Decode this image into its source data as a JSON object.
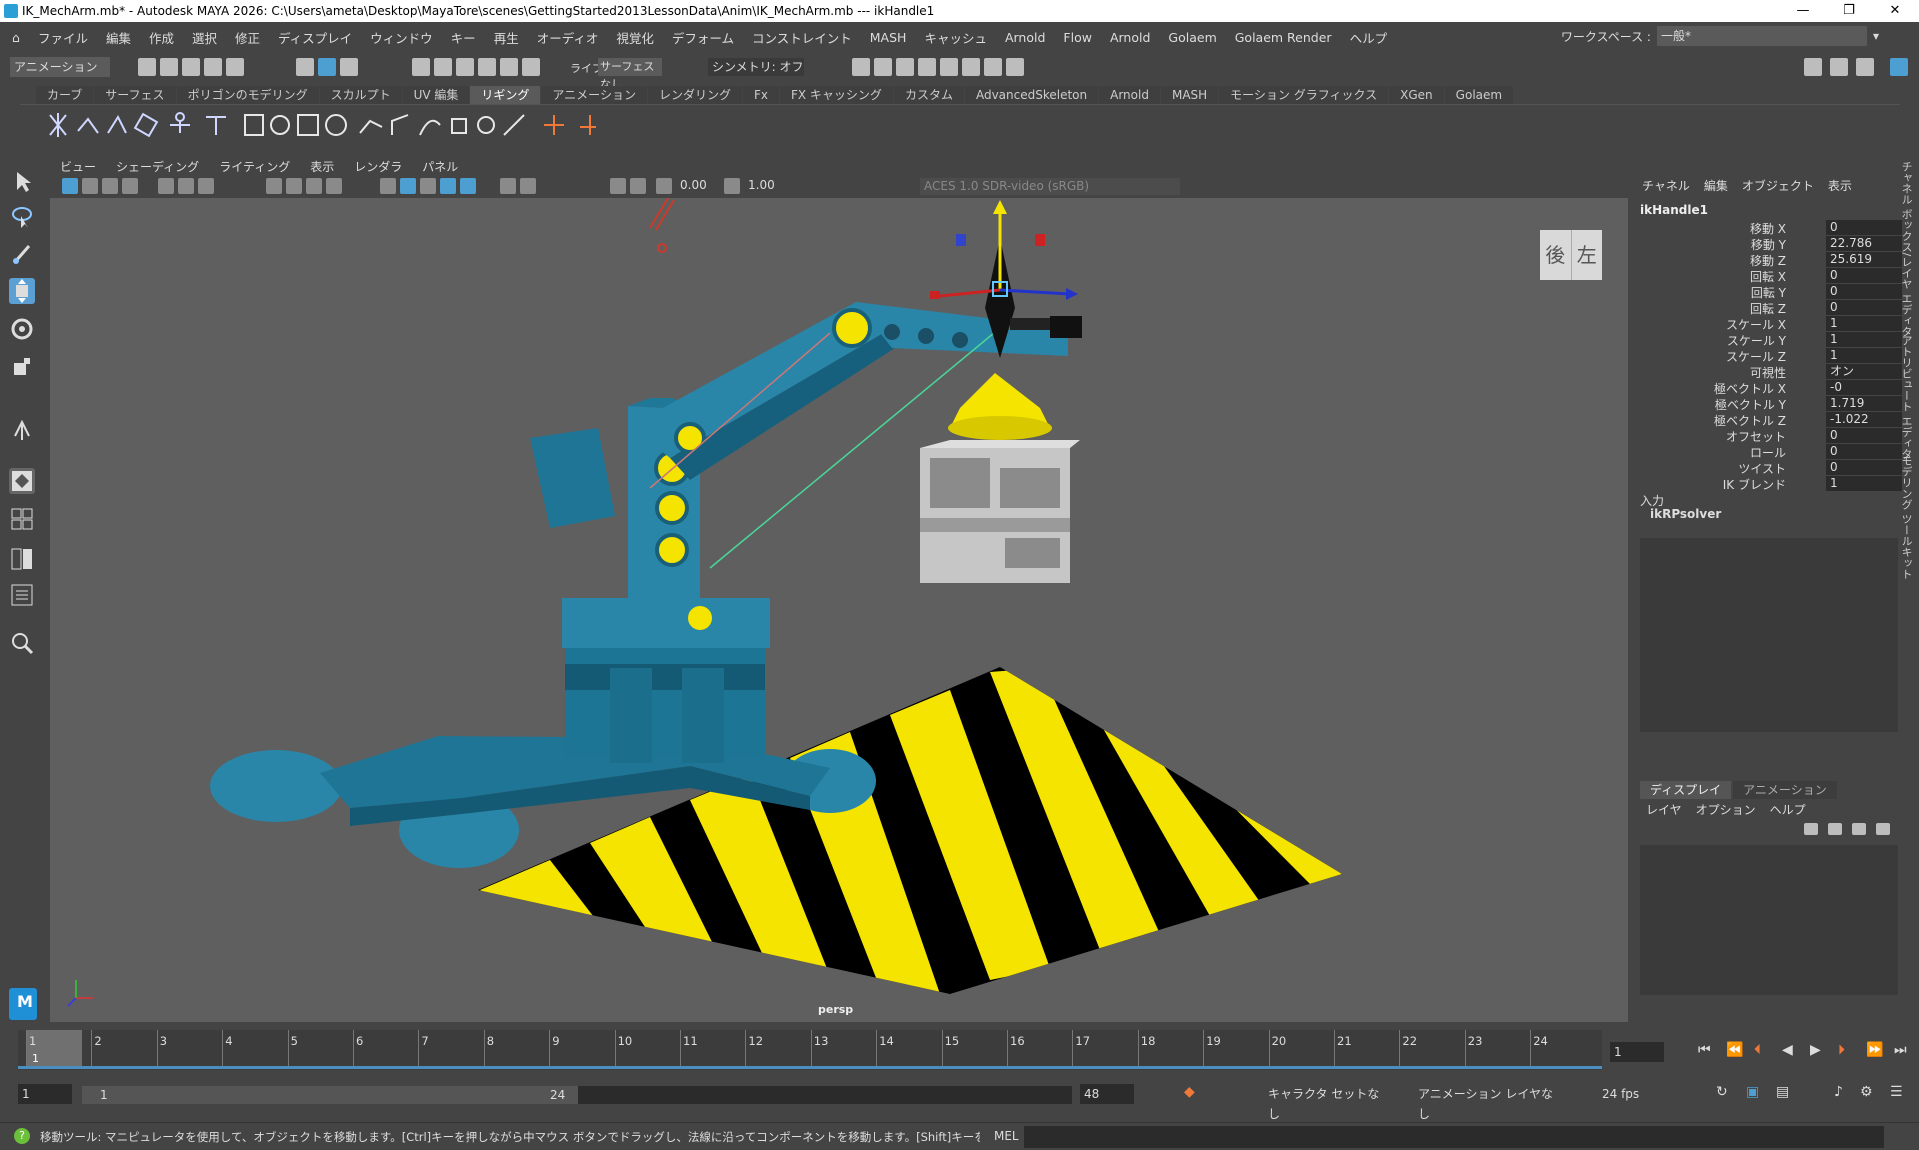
{
  "window": {
    "title": "IK_MechArm.mb* - Autodesk MAYA 2026: C:\\Users\\ameta\\Desktop\\MayaTore\\scenes\\GettingStarted2013LessonData\\Anim\\IK_MechArm.mb   ---   ikHandle1",
    "minimize": "—",
    "maximize": "❐",
    "close": "✕"
  },
  "menubar": {
    "items": [
      "ファイル",
      "編集",
      "作成",
      "選択",
      "修正",
      "ディスプレイ",
      "ウィンドウ",
      "キー",
      "再生",
      "オーディオ",
      "視覚化",
      "デフォーム",
      "コンストレイント",
      "MASH",
      "キャッシュ",
      "Arnold",
      "Flow",
      "Arnold",
      "Golaem",
      "Golaem Render",
      "ヘルプ"
    ],
    "workspace_label": "ワークスペース :",
    "workspace_value": "一般*"
  },
  "statusline": {
    "mode": "アニメーション",
    "live_label": "ライブ",
    "live_value": "サーフェスなし",
    "symmetry": "シンメトリ: オフ"
  },
  "shelf": {
    "tabs": [
      "カーブ",
      "サーフェス",
      "ポリゴンのモデリング",
      "スカルプト",
      "UV 編集",
      "リギング",
      "アニメーション",
      "レンダリング",
      "Fx",
      "FX キャッシング",
      "カスタム",
      "AdvancedSkeleton",
      "Arnold",
      "MASH",
      "モーション グラフィックス",
      "XGen",
      "Golaem"
    ],
    "active_tab": "リギング"
  },
  "panel": {
    "menus": [
      "ビュー",
      "シェーディング",
      "ライティング",
      "表示",
      "レンダラ",
      "パネル"
    ],
    "exposure": "0.00",
    "gamma": "1.00",
    "colorspace": "ACES 1.0 SDR-video (sRGB)",
    "camera": "persp",
    "viewcube_back": "後",
    "viewcube_left": "左"
  },
  "channelbox": {
    "menus": [
      "チャネル",
      "編集",
      "オブジェクト",
      "表示"
    ],
    "object": "ikHandle1",
    "attributes": [
      {
        "label": "移動 X",
        "value": "0"
      },
      {
        "label": "移動 Y",
        "value": "22.786"
      },
      {
        "label": "移動 Z",
        "value": "25.619"
      },
      {
        "label": "回転 X",
        "value": "0"
      },
      {
        "label": "回転 Y",
        "value": "0"
      },
      {
        "label": "回転 Z",
        "value": "0"
      },
      {
        "label": "スケール X",
        "value": "1"
      },
      {
        "label": "スケール Y",
        "value": "1"
      },
      {
        "label": "スケール Z",
        "value": "1"
      },
      {
        "label": "可視性",
        "value": "オン"
      },
      {
        "label": "極ベクトル X",
        "value": "-0"
      },
      {
        "label": "極ベクトル Y",
        "value": "1.719"
      },
      {
        "label": "極ベクトル Z",
        "value": "-1.022"
      },
      {
        "label": "オフセット",
        "value": "0"
      },
      {
        "label": "ロール",
        "value": "0"
      },
      {
        "label": "ツイスト",
        "value": "0"
      },
      {
        "label": "IK ブレンド",
        "value": "1"
      }
    ],
    "inputs_label": "入力",
    "inputs_name": "ikRPsolver",
    "side_tabs": [
      "チャネル ボックス/レイヤ エディタ",
      "アトリビュート エディタ",
      "モデリング ツールキット"
    ]
  },
  "layers": {
    "tabs": [
      "ディスプレイ",
      "アニメーション"
    ],
    "menus": [
      "レイヤ",
      "オプション",
      "ヘルプ"
    ]
  },
  "timeline": {
    "ticks": [
      "1",
      "2",
      "3",
      "4",
      "5",
      "6",
      "7",
      "8",
      "9",
      "10",
      "11",
      "12",
      "13",
      "14",
      "15",
      "16",
      "17",
      "18",
      "19",
      "20",
      "21",
      "22",
      "23",
      "24"
    ],
    "current_frame": "1",
    "current_frame_marker": "1"
  },
  "range": {
    "start": "1",
    "inner_start": "1",
    "inner_end": "24",
    "end": "48",
    "character_set": "キャラクタ セットなし",
    "anim_layer": "アニメーション レイヤなし",
    "fps": "24 fps"
  },
  "helpline": {
    "message": "移動ツール: マニピュレータを使用して、オブジェクトを移動します。[Ctrl]キーを押しながら中マウス ボタンでドラッグし、法線に沿ってコンポーネントを移動します。[Shift]キーを押しながらマニピュレータの軸または平面ハンドルをドラッ",
    "mel": "MEL"
  },
  "colors": {
    "arm": "#1a6f8c",
    "accent_yellow": "#f5e400",
    "stripe_black": "#000000",
    "box_gray": "#bdbdbd"
  }
}
